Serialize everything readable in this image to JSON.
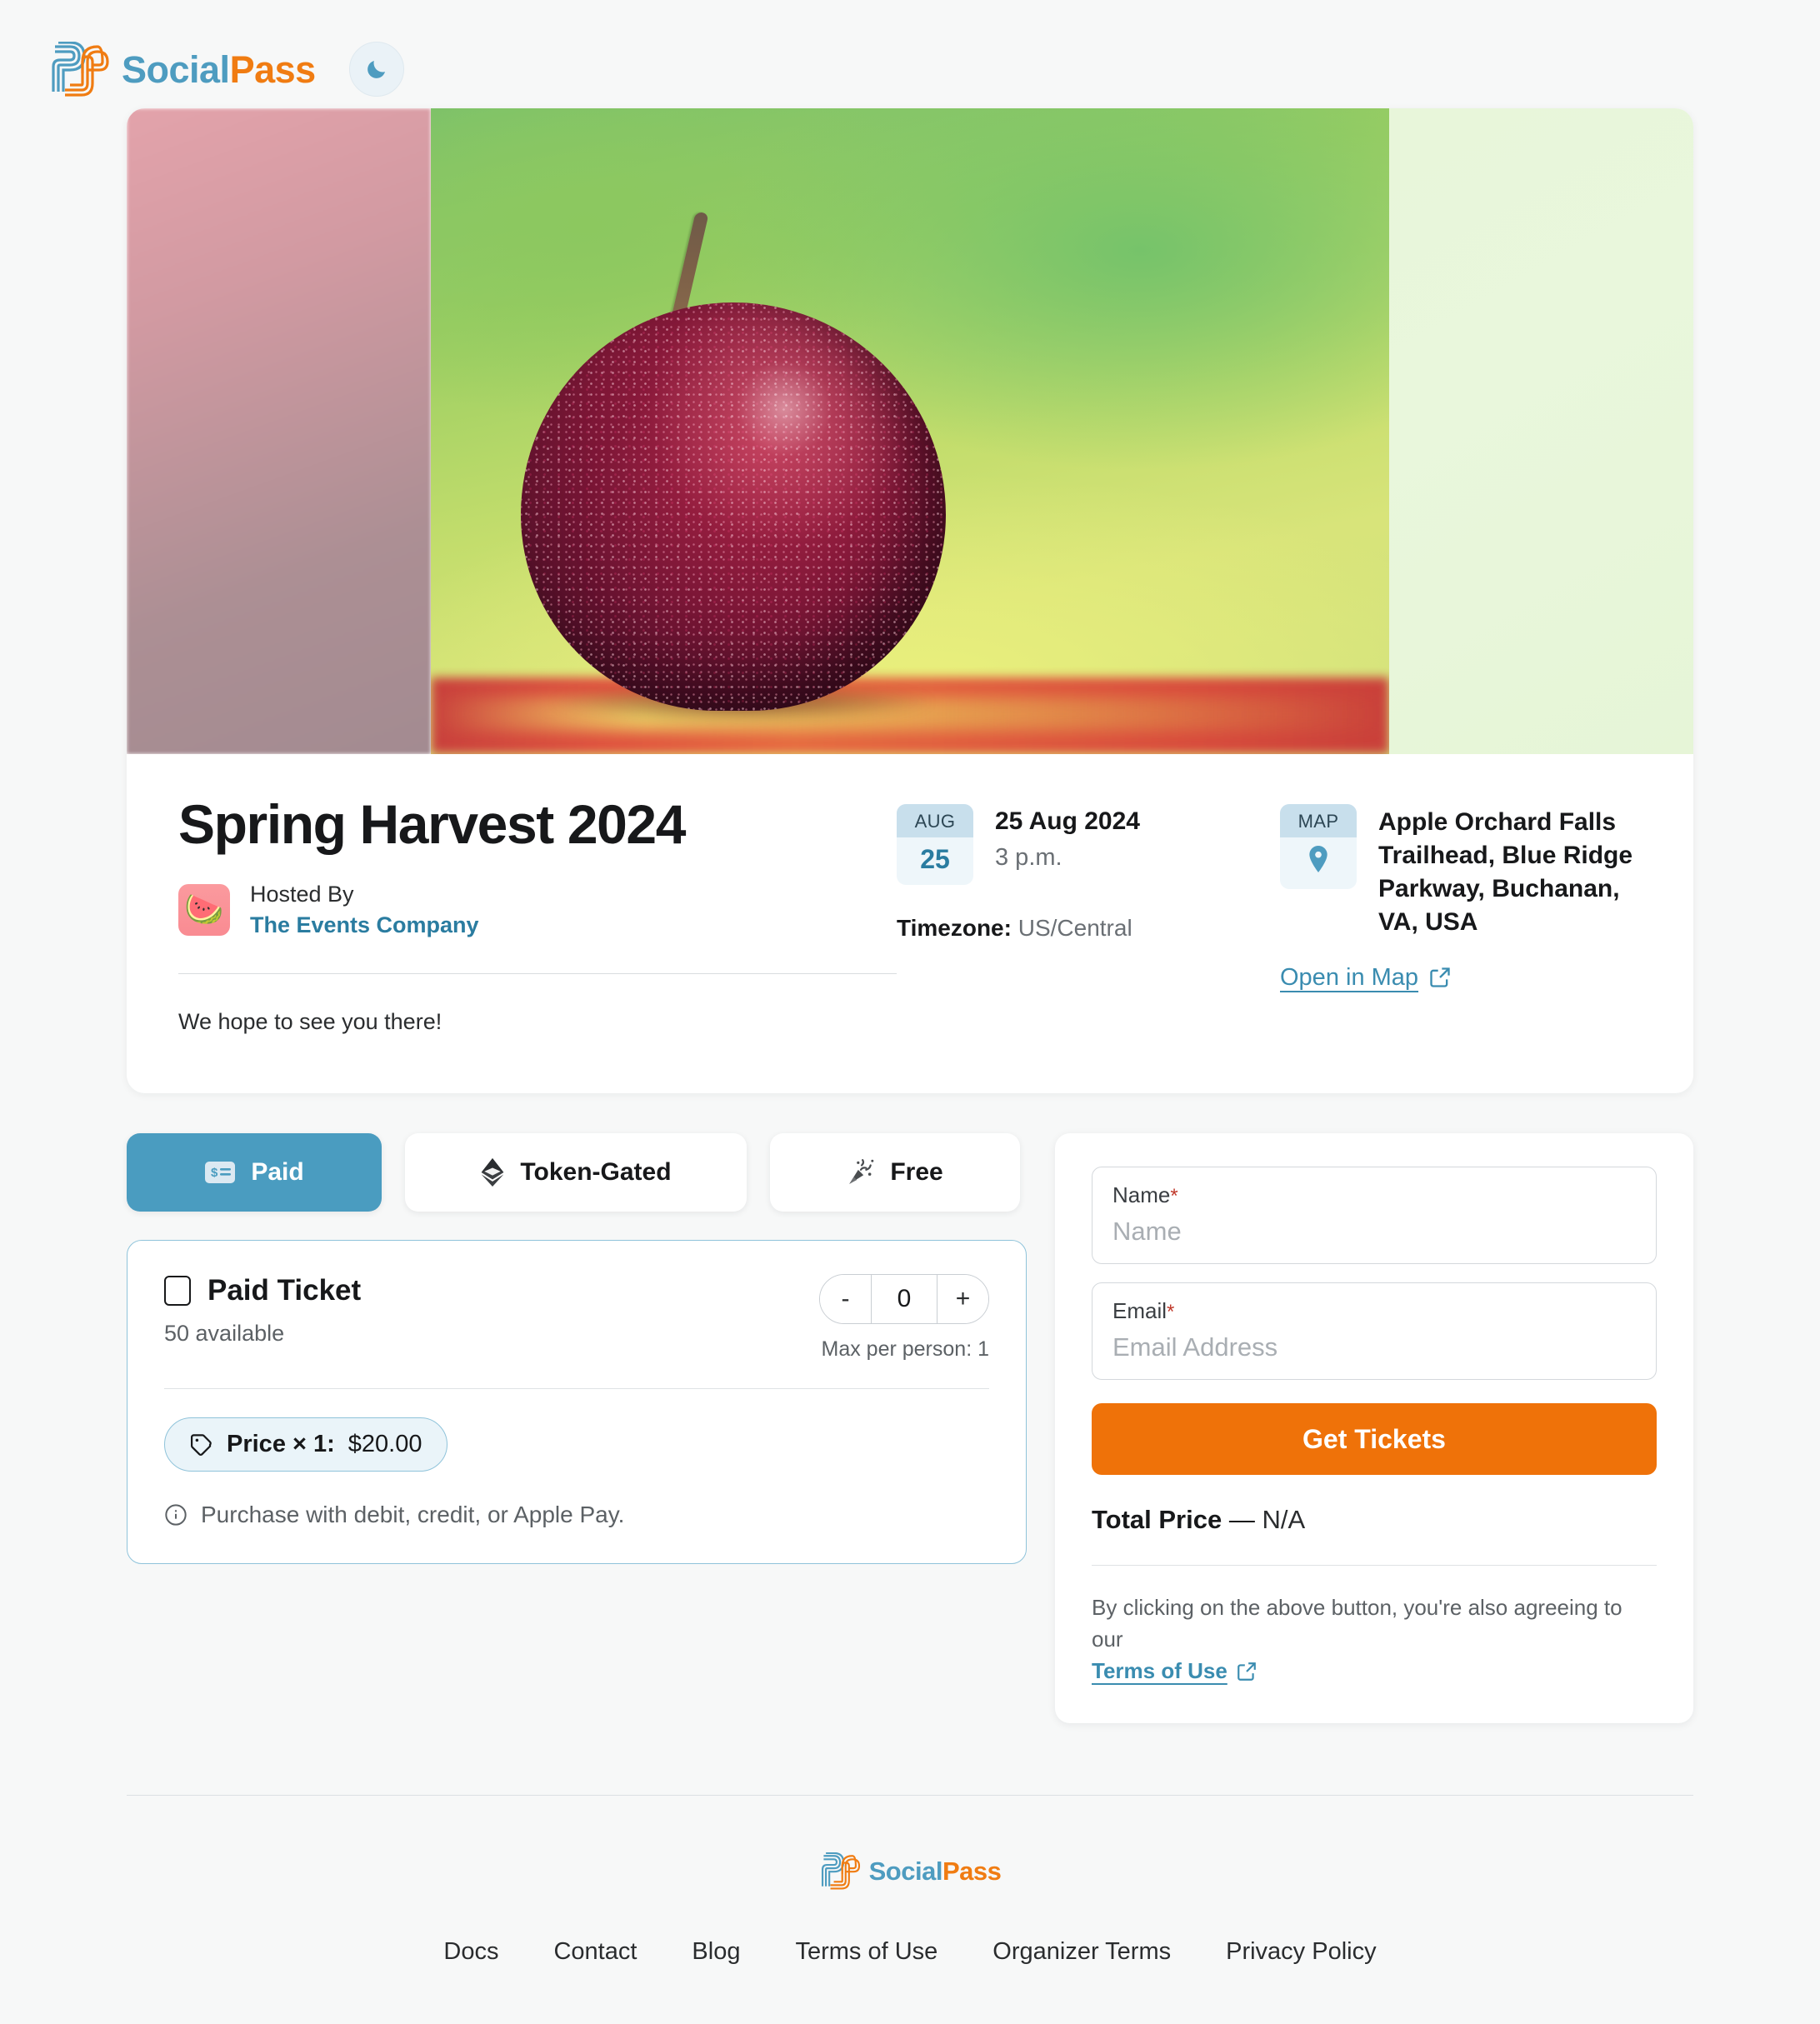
{
  "header": {
    "brand_first": "Social",
    "brand_second": "Pass",
    "theme_toggle_icon": "moon-icon"
  },
  "event": {
    "title": "Spring Harvest 2024",
    "hosted_by_label": "Hosted By",
    "host_name": "The Events Company",
    "host_avatar_emoji": "🍉",
    "description": "We hope to see you there!",
    "date": {
      "chip_month": "AUG",
      "chip_day": "25",
      "full_date": "25 Aug 2024",
      "time": "3 p.m.",
      "timezone_label": "Timezone:",
      "timezone_value": "US/Central"
    },
    "location": {
      "chip_label": "MAP",
      "chip_icon": "map-pin-icon",
      "address": "Apple Orchard Falls Trailhead, Blue Ridge Parkway, Buchanan, VA, USA",
      "open_in_map": "Open in Map"
    }
  },
  "ticket_tabs": [
    {
      "label": "Paid",
      "icon": "money-banknote-icon",
      "active": true
    },
    {
      "label": "Token-Gated",
      "icon": "ethereum-icon",
      "active": false
    },
    {
      "label": "Free",
      "icon": "party-popper-icon",
      "active": false
    }
  ],
  "ticket": {
    "name": "Paid Ticket",
    "available": "50 available",
    "max_per_person": "Max per person: 1",
    "quantity": "0",
    "decrement_label": "-",
    "increment_label": "+",
    "price_badge_prefix": "Price × 1:",
    "price_badge_value": "$20.00",
    "price_icon": "tag-icon",
    "purchase_note": "Purchase with debit, credit, or Apple Pay.",
    "purchase_note_icon": "info-icon"
  },
  "form": {
    "name_label": "Name",
    "name_required": "*",
    "name_placeholder": "Name",
    "name_value": "",
    "email_label": "Email",
    "email_required": "*",
    "email_placeholder": "Email Address",
    "email_value": "",
    "submit_label": "Get Tickets",
    "total_label": "Total Price",
    "total_separator": "—",
    "total_value": "N/A",
    "tos_text": "By clicking on the above button, you're also agreeing to our",
    "tos_link": "Terms of Use",
    "external_icon": "external-link-icon"
  },
  "footer": {
    "brand_first": "Social",
    "brand_second": "Pass",
    "links": [
      "Docs",
      "Contact",
      "Blog",
      "Terms of Use",
      "Organizer Terms",
      "Privacy Policy"
    ]
  },
  "colors": {
    "brand_blue": "#4e9cc0",
    "brand_orange": "#f07c12",
    "cta_orange": "#ef7209",
    "active_tab": "#4a9cc0",
    "link_blue": "#3a8cb0",
    "page_bg": "#f7f8f8",
    "required_red": "#c0392b"
  }
}
